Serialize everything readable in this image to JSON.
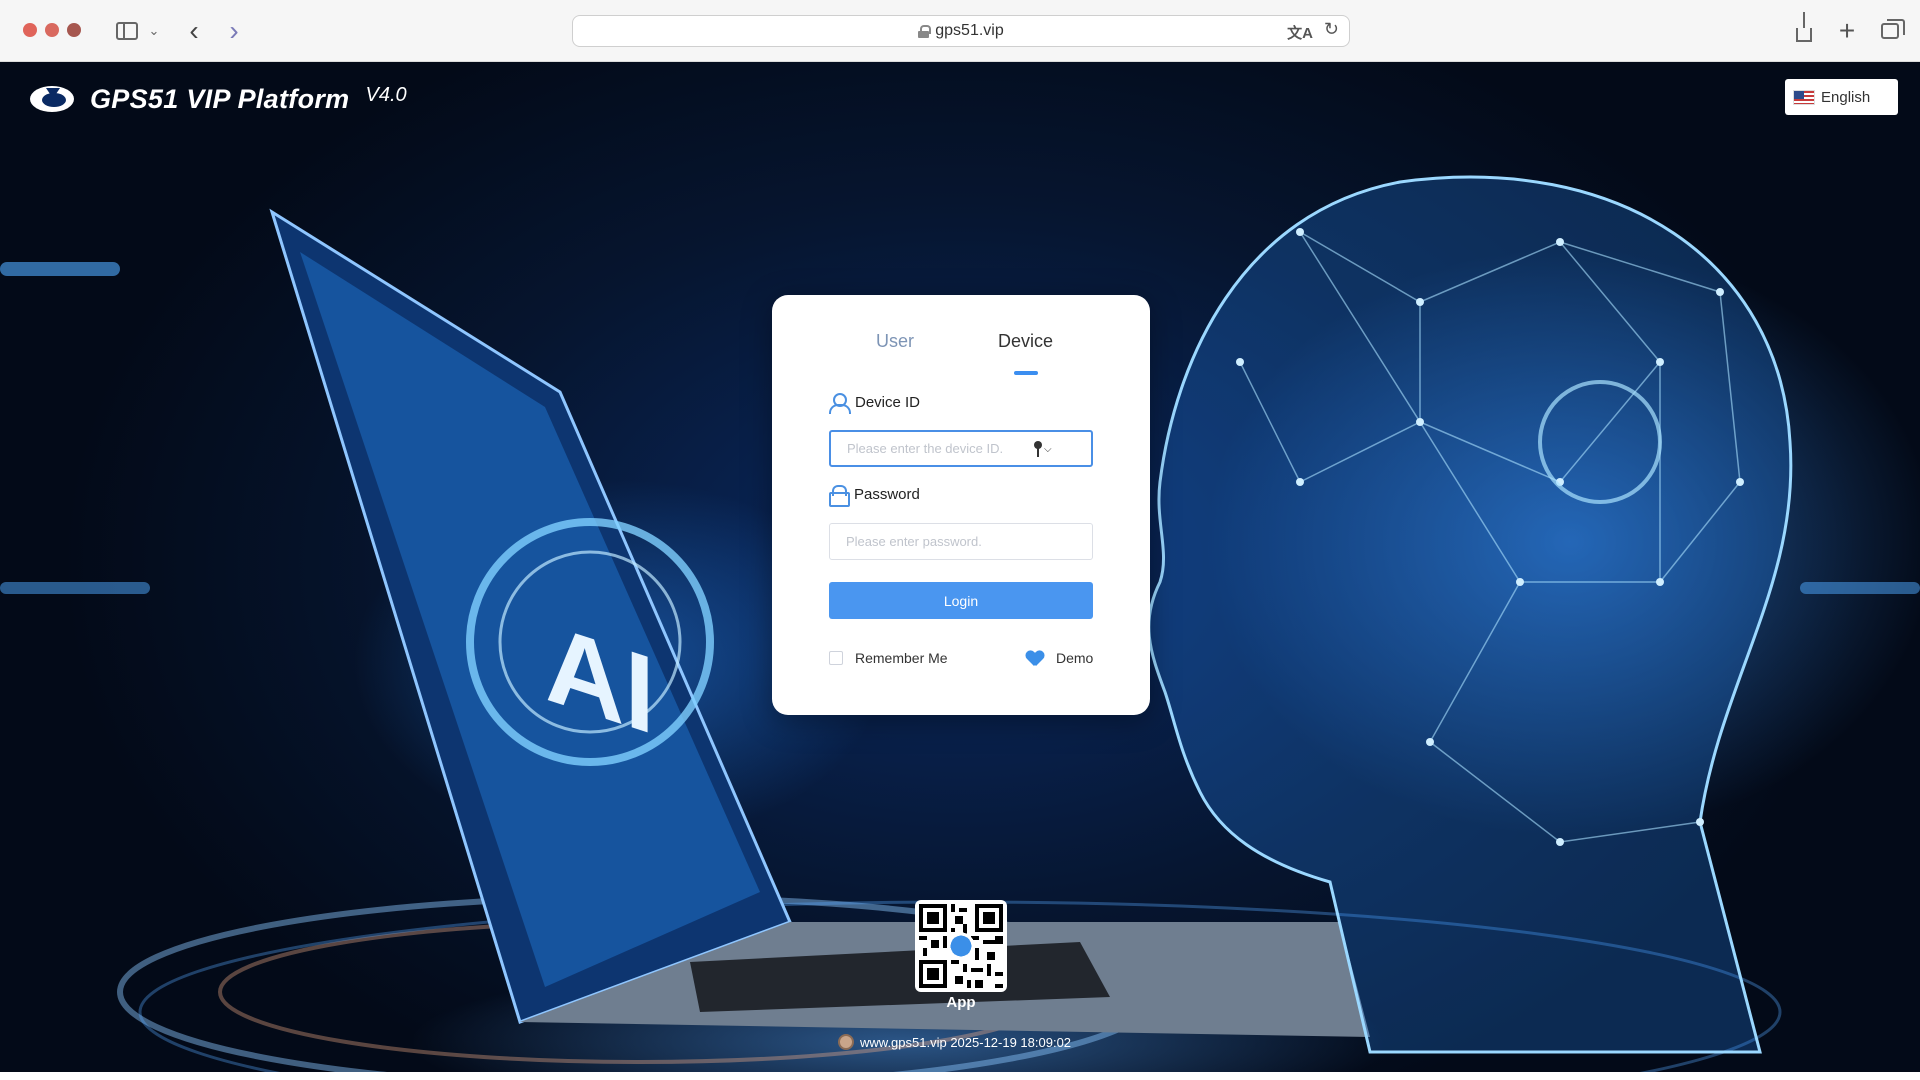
{
  "browser": {
    "url": "gps51.vip"
  },
  "header": {
    "title": "GPS51 VIP Platform",
    "version": "V4.0",
    "language": "English"
  },
  "login": {
    "tabs": [
      {
        "label": "User",
        "active": false
      },
      {
        "label": "Device",
        "active": true
      }
    ],
    "device_id_label": "Device ID",
    "device_id_placeholder": "Please enter the device ID.",
    "password_label": "Password",
    "password_placeholder": "Please enter password.",
    "login_button": "Login",
    "remember_me": "Remember Me",
    "demo": "Demo"
  },
  "footer": {
    "app_label": "App",
    "text": "www.gps51.vip 2025-12-19 18:09:02"
  },
  "colors": {
    "accent": "#4a96f0",
    "tab_inactive": "#7d94b5",
    "background_dark": "#06152f"
  }
}
